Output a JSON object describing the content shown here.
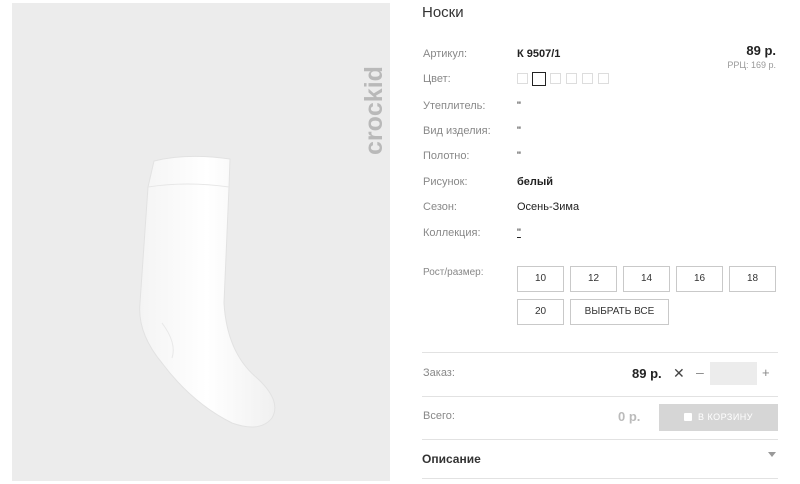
{
  "brand": "crockid",
  "product": {
    "title": "Носки",
    "price": "89 р.",
    "rrp": "РРЦ: 169 р."
  },
  "specs": [
    {
      "label": "Артикул:",
      "value": "К 9507/1"
    },
    {
      "label": "Цвет:",
      "value": ""
    },
    {
      "label": "Утеплитель:",
      "value": "\""
    },
    {
      "label": "Вид изделия:",
      "value": "\""
    },
    {
      "label": "Полотно:",
      "value": "\""
    },
    {
      "label": "Рисунок:",
      "value": "белый"
    },
    {
      "label": "Сезон:",
      "value": "Осень-Зима"
    },
    {
      "label": "Коллекция:",
      "value": "\""
    }
  ],
  "sizes": {
    "label": "Рост/размер:",
    "options": [
      "10",
      "12",
      "14",
      "16",
      "18",
      "20"
    ],
    "select_all": "ВЫБРАТЬ ВСЕ"
  },
  "order": {
    "label": "Заказ:",
    "price": "89 р.",
    "times": "✕",
    "minus": "–",
    "plus": "+",
    "quantity": ""
  },
  "total": {
    "label": "Всего:",
    "value": "0 р.",
    "cart_button": "В КОРЗИНУ"
  },
  "description": {
    "label": "Описание"
  },
  "colors": {
    "photo_bg": "#ececec",
    "cart_button_bg": "#d6d6d6"
  }
}
